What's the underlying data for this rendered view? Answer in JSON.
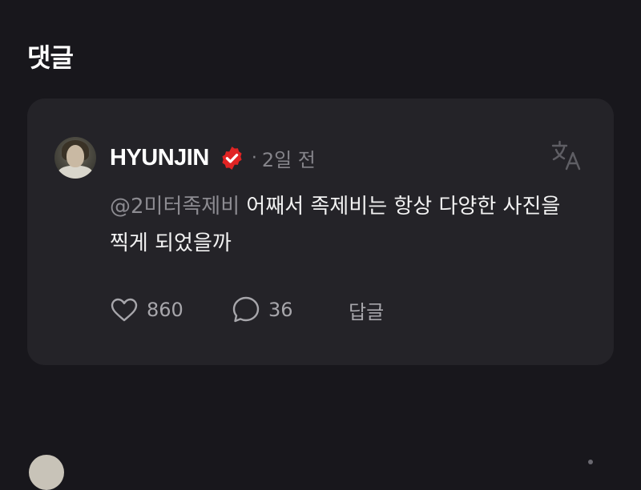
{
  "section": {
    "title": "댓글"
  },
  "comment": {
    "author": "HYUNJIN",
    "separator": "·",
    "time": "2일 전",
    "mention": "@2미터족제비",
    "text": " 어째서 족제비는 항상 다양한 사진을 찍게 되었을까",
    "likes": "860",
    "replies": "36",
    "reply_label": "답글"
  },
  "icons": {
    "verified": "verified-badge-icon",
    "translate": "translate-icon",
    "like": "heart-icon",
    "replies": "speech-bubble-icon"
  },
  "colors": {
    "background": "#18171c",
    "card": "#242328",
    "verified_badge": "#e02424",
    "muted_text": "#85848a"
  }
}
